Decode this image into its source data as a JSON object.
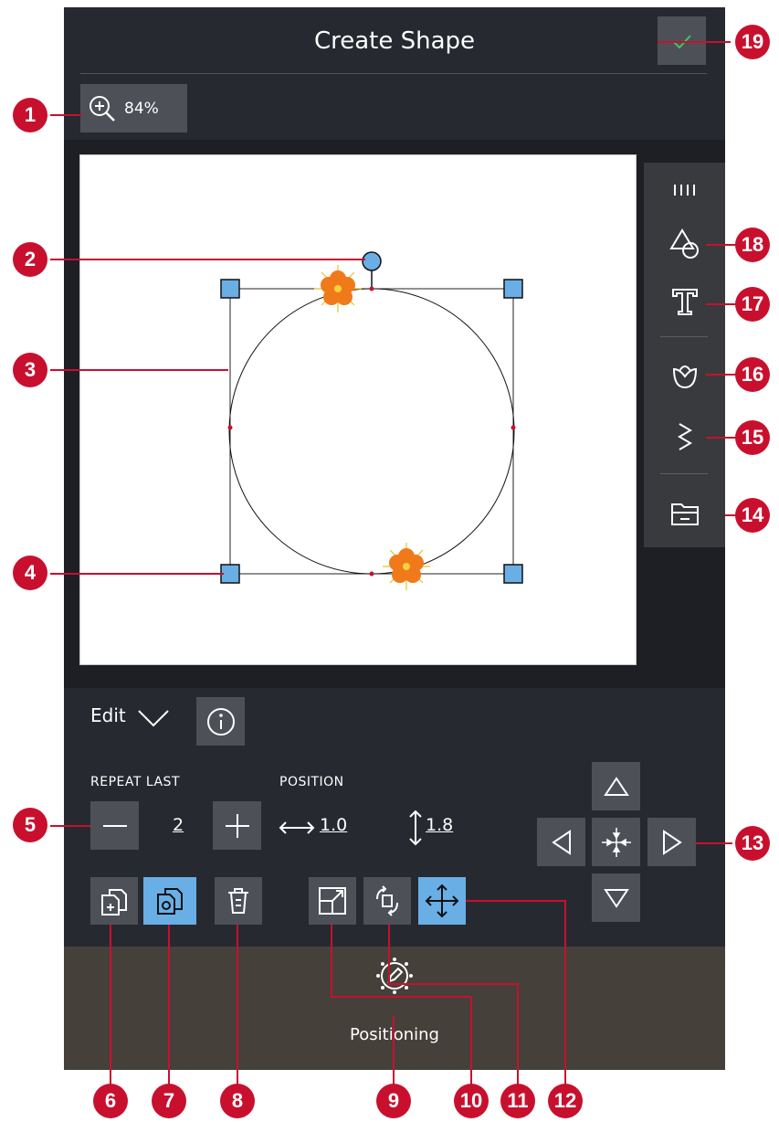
{
  "header": {
    "title": "Create Shape"
  },
  "zoom": {
    "value": "84%"
  },
  "edit": {
    "label": "Edit"
  },
  "repeat_last": {
    "label": "REPEAT LAST",
    "value": "2"
  },
  "position": {
    "label": "POSITION",
    "x": "1.0",
    "y": "1.8"
  },
  "bottom": {
    "positioning_label": "Positioning"
  },
  "callouts": {
    "c1": "1",
    "c2": "2",
    "c3": "3",
    "c4": "4",
    "c5": "5",
    "c6": "6",
    "c7": "7",
    "c8": "8",
    "c9": "9",
    "c10": "10",
    "c11": "11",
    "c12": "12",
    "c13": "13",
    "c14": "14",
    "c15": "15",
    "c16": "16",
    "c17": "17",
    "c18": "18",
    "c19": "19"
  },
  "colors": {
    "accent_blue": "#6aaee6",
    "callout_red": "#c8102e",
    "panel_dark": "#262930",
    "button_gray": "#4d5057",
    "bottom_bar": "#45403a"
  },
  "icons": [
    "zoom-in-icon",
    "checkmark-icon",
    "handle-icon",
    "shapes-icon",
    "text-icon",
    "tulip-icon",
    "zigzag-stitch-icon",
    "folder-icon",
    "info-icon",
    "chevron-down-icon",
    "minus-icon",
    "plus-icon",
    "horizontal-arrows-icon",
    "vertical-arrows-icon",
    "duplicate-icon",
    "duplicate-active-icon",
    "trash-icon",
    "scale-icon",
    "rotate-icon",
    "move-icon",
    "arrow-up-icon",
    "arrow-left-icon",
    "center-icon",
    "arrow-right-icon",
    "arrow-down-icon",
    "positioning-icon",
    "flower-motif-icon"
  ]
}
